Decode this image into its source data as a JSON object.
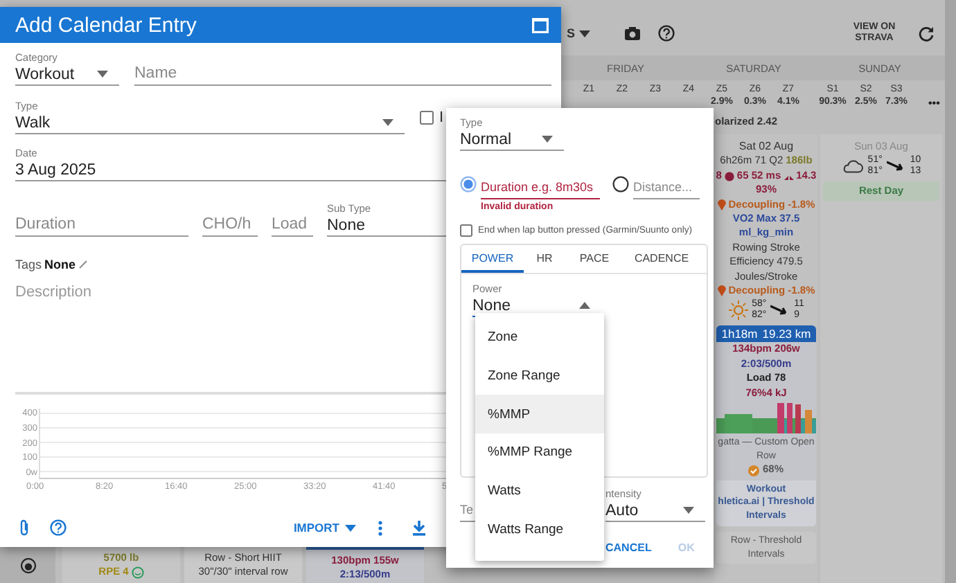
{
  "background": {
    "toolbar": {
      "menu_fragment": "S",
      "view_button": "VIEW ON STRAVA"
    },
    "day_headers": [
      "FRIDAY",
      "SATURDAY",
      "SUNDAY"
    ],
    "zones": [
      {
        "label": "Z1"
      },
      {
        "label": "Z2"
      },
      {
        "label": "Z3"
      },
      {
        "label": "Z4"
      },
      {
        "label": "Z5",
        "value": "2.9%"
      },
      {
        "label": "Z6",
        "value": "0.3%"
      },
      {
        "label": "Z7",
        "value": "4.1%"
      },
      {
        "label": "S1",
        "value": "90.3%"
      },
      {
        "label": "S2",
        "value": "2.5%"
      },
      {
        "label": "S3",
        "value": "7.3%"
      }
    ],
    "more": "•••",
    "polarized": "olarized 2.42",
    "saturday": {
      "date": "Sat 02 Aug",
      "lines": [
        [
          {
            "text": "6h26m 71 Q2",
            "kind": "summary"
          },
          {
            "text": "186lb",
            "kind": "weight"
          }
        ],
        [
          {
            "text": "8",
            "kind": "hrv"
          },
          {
            "text": "65 52 ms",
            "kind": "resting_hr"
          },
          {
            "text": "14.3",
            "kind": "respiration"
          }
        ],
        [
          {
            "text": "93%",
            "kind": "hrv"
          }
        ],
        [
          {
            "text": "Decoupling -1.8%",
            "kind": "decoupling"
          }
        ],
        [
          {
            "text": "VO2 Max 37.5",
            "kind": "vo2"
          }
        ],
        [
          {
            "text": "ml_kg_min",
            "kind": "vo2"
          }
        ],
        [
          {
            "text": "Rowing Stroke",
            "kind": "plain"
          }
        ],
        [
          {
            "text": "Efficiency 479.5",
            "kind": "plain"
          }
        ],
        [
          {
            "text": "Joules/Stroke",
            "kind": "plain"
          }
        ],
        [
          {
            "text": "Decoupling -1.8%",
            "kind": "decoupling"
          }
        ]
      ],
      "weather": {
        "kind": "sun",
        "temps": [
          "58°",
          "82°"
        ],
        "wind": [
          "11",
          "9"
        ]
      },
      "activity": {
        "duration": "1h18m",
        "distance": "19.23 km",
        "stats": [
          {
            "text": "134bpm 206w",
            "kind": "hr"
          },
          {
            "text": "2:03/500m",
            "kind": "pace"
          },
          {
            "text": "Load 78",
            "kind": "load"
          },
          {
            "text": "76%4 kJ",
            "kind": "hr"
          }
        ],
        "title": "gatta — Custom Open Row",
        "score": "68%",
        "workout": [
          "Workout",
          "hletica.ai | Threshold",
          "Intervals"
        ]
      },
      "planned": "Row - Threshold Intervals"
    },
    "sunday": {
      "date": "Sun 03 Aug",
      "weather": {
        "kind": "cloud",
        "temps": [
          "51°",
          "81°"
        ],
        "wind": [
          "10",
          "13"
        ]
      },
      "note": "Rest Day"
    },
    "week_cards": [
      {
        "kind": "done",
        "lines": [
          {
            "text": "5700 lb",
            "kind": "weight"
          },
          {
            "text": "RPE 4",
            "kind": "rpe"
          }
        ]
      },
      {
        "kind": "planned",
        "lines": [
          {
            "text": "Row - Short HIIT",
            "kind": "plain"
          },
          {
            "text": "30\"/30\" interval row",
            "kind": "plain"
          }
        ]
      },
      {
        "kind": "completed",
        "lines": [
          {
            "text": "130bpm 155w",
            "kind": "hr"
          },
          {
            "text": "2:13/500m",
            "kind": "pace"
          }
        ]
      }
    ]
  },
  "dialog": {
    "title": "Add Calendar Entry",
    "category": {
      "label": "Category",
      "value": "Workout"
    },
    "name": {
      "placeholder": "Name"
    },
    "type": {
      "label": "Type",
      "value": "Walk"
    },
    "indoor": {
      "label": "I",
      "checked": false
    },
    "date": {
      "label": "Date",
      "value": "3 Aug 2025"
    },
    "duration": {
      "placeholder": "Duration"
    },
    "cho": {
      "placeholder": "CHO/h"
    },
    "load": {
      "placeholder": "Load"
    },
    "sub_type": {
      "label": "Sub Type",
      "value": "None"
    },
    "tags": {
      "label": "Tags",
      "value": "None"
    },
    "description": {
      "placeholder": "Description"
    },
    "chart": {
      "yticks": [
        "400",
        "300",
        "200",
        "100",
        "0w"
      ],
      "xticks": [
        "0:00",
        "8:20",
        "16:40",
        "25:00",
        "33:20",
        "41:40",
        "5"
      ]
    },
    "import_button": "IMPORT"
  },
  "popup": {
    "type": {
      "label": "Type",
      "value": "Normal"
    },
    "targets": [
      {
        "placeholder": "Duration e.g. 8m30s",
        "selected": true,
        "error": "Invalid duration"
      },
      {
        "placeholder": "Distance...",
        "selected": false
      }
    ],
    "lap_button": {
      "label": "End when lap button pressed (Garmin/Suunto only)",
      "checked": false
    },
    "tabs": [
      {
        "label": "POWER",
        "selected": true
      },
      {
        "label": "HR",
        "selected": false
      },
      {
        "label": "PACE",
        "selected": false
      },
      {
        "label": "CADENCE",
        "selected": false
      }
    ],
    "power": {
      "label": "Power",
      "value": "None",
      "expanded": true
    },
    "menu": [
      {
        "label": "Zone",
        "highlighted": false
      },
      {
        "label": "Zone Range",
        "highlighted": false
      },
      {
        "label": "%MMP",
        "highlighted": true
      },
      {
        "label": "%MMP Range",
        "highlighted": false
      },
      {
        "label": "Watts",
        "highlighted": false
      },
      {
        "label": "Watts Range",
        "highlighted": false
      }
    ],
    "text_field": {
      "placeholder": "Te"
    },
    "intensity": {
      "label": "ntensity",
      "value": "Auto"
    },
    "buttons": [
      {
        "label": "CANCEL",
        "disabled": false
      },
      {
        "label": "OK",
        "disabled": true
      }
    ]
  }
}
